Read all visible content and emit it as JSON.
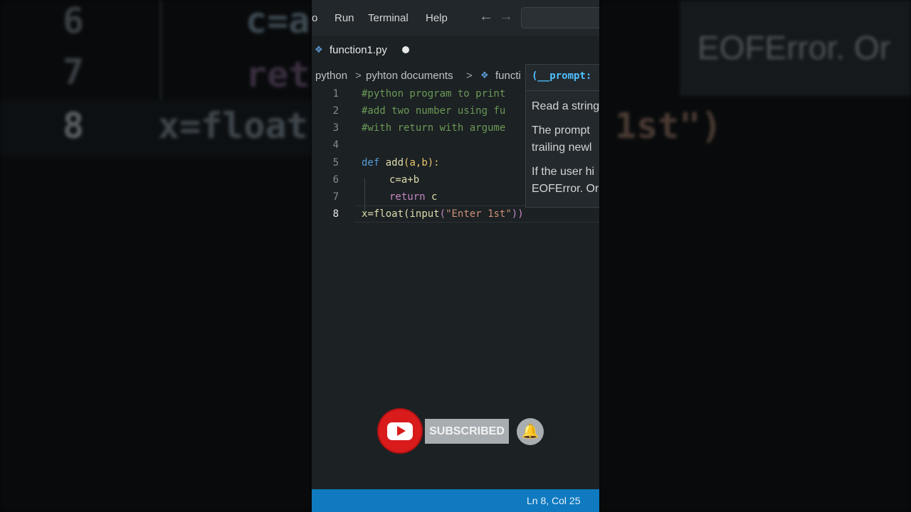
{
  "background": {
    "left_line_numbers": [
      "6",
      "7",
      "8"
    ],
    "left_code": [
      "c=a",
      "ret",
      "x=float"
    ],
    "right_code": "1st\")",
    "right_tooltip": [
      "EOFError. Or"
    ]
  },
  "menubar": {
    "items": [
      "o",
      "Run",
      "Terminal",
      "Help"
    ],
    "back_icon": "arrow-left-icon",
    "forward_icon": "arrow-right-icon"
  },
  "tab": {
    "label": "function1.py",
    "icon": "python-file-icon"
  },
  "breadcrumb": {
    "parts": [
      "python",
      "pyhton documents",
      "functi"
    ],
    "separator": ">"
  },
  "editor": {
    "line_numbers": [
      "1",
      "2",
      "3",
      "4",
      "5",
      "6",
      "7",
      "8"
    ],
    "active_line": "8",
    "lines": [
      {
        "comment": "#python program to print"
      },
      {
        "comment": "#add two number using fu"
      },
      {
        "comment": "#with return with argume"
      },
      {},
      {
        "kw": "def",
        "fn": "add",
        "rest": "(a,b):"
      },
      {
        "text": "c=a+b"
      },
      {
        "ctl": "return",
        "text": " c"
      },
      {
        "var": "x",
        "text1": "=",
        "fn1": "float",
        "p1": "(",
        "fn2": "input",
        "p2": "(",
        "str": "\"Enter 1st\"",
        "p3": "))"
      }
    ]
  },
  "hover": {
    "title": "(__prompt:",
    "lines": [
      "Read a string",
      "The prompt",
      "trailing newl",
      "If the user hi",
      "EOFError. Or"
    ]
  },
  "subscribe": {
    "label": "SUBSCRIBED",
    "icons": [
      "youtube-icon",
      "bell-icon"
    ]
  },
  "statusbar": {
    "position": "Ln 8, Col 25"
  },
  "colors": {
    "statusbar": "#0f7ac0",
    "comment": "#6a9955",
    "keyword": "#569cd6",
    "function": "#dcdcaa",
    "string": "#ce9178",
    "youtube_red": "#d91b1b"
  }
}
